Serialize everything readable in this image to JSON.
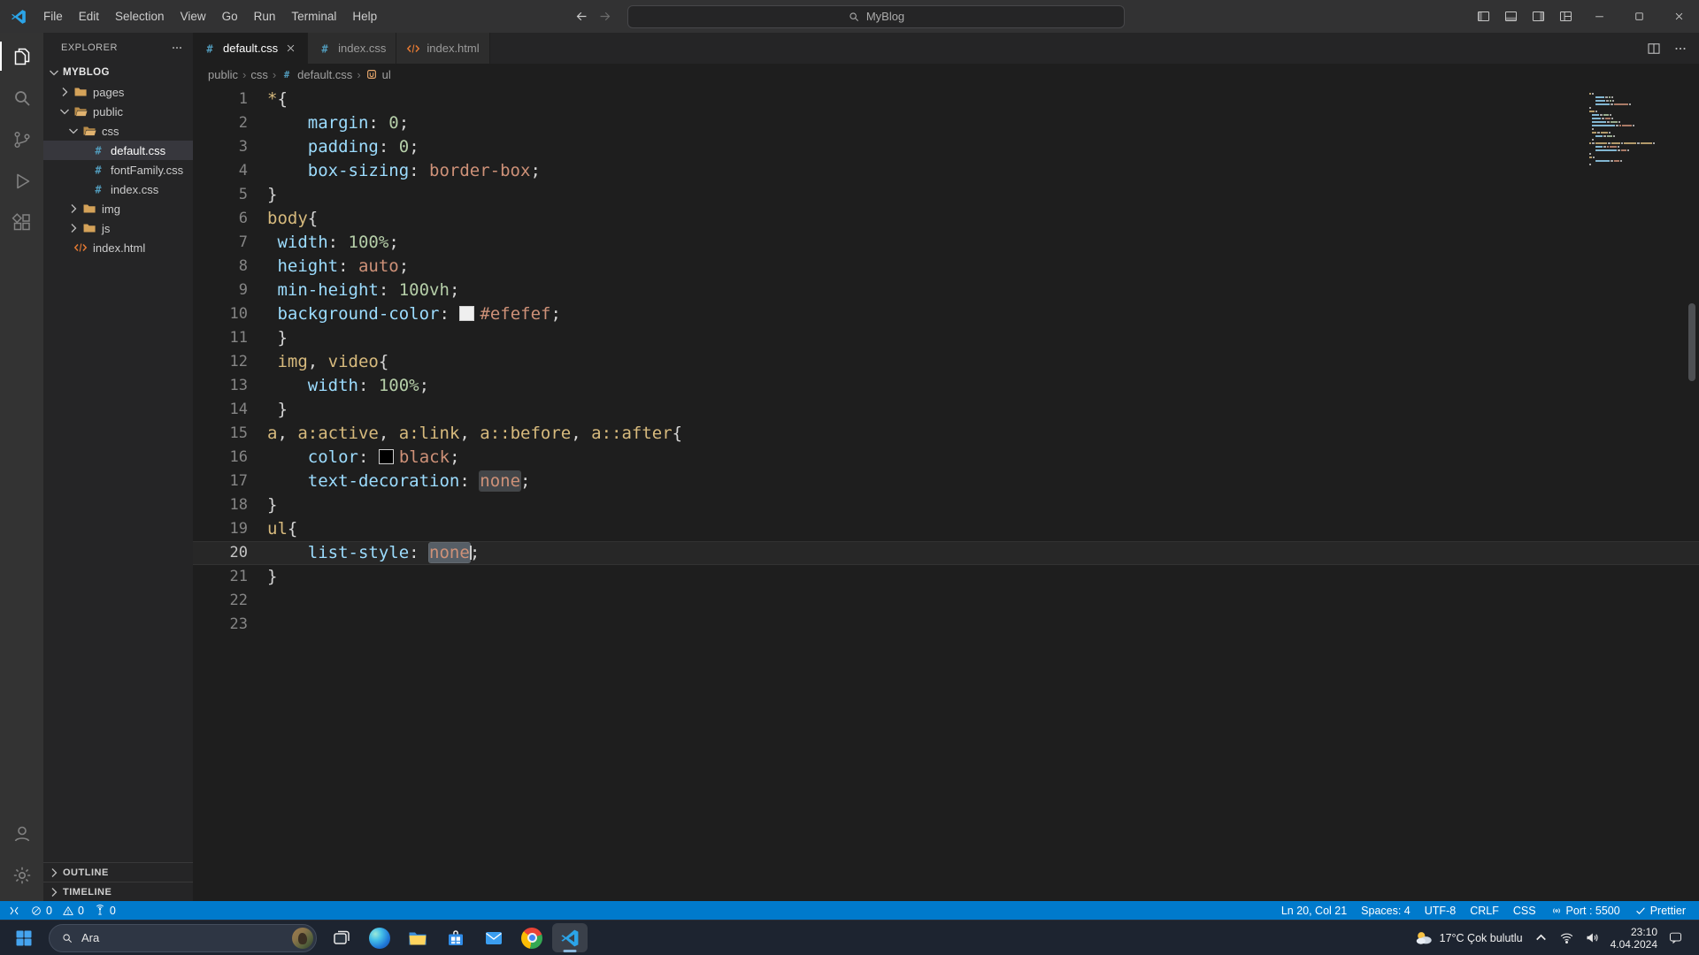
{
  "title_bar": {
    "menus": [
      "File",
      "Edit",
      "Selection",
      "View",
      "Go",
      "Run",
      "Terminal",
      "Help"
    ],
    "search_label": "MyBlog"
  },
  "activity_bar": {
    "top": [
      {
        "id": "explorer",
        "icon": "files",
        "active": true
      },
      {
        "id": "search",
        "icon": "search",
        "active": false
      },
      {
        "id": "source-control",
        "icon": "scm",
        "active": false
      },
      {
        "id": "run-and-debug",
        "icon": "debug",
        "active": false
      },
      {
        "id": "extensions",
        "icon": "extensions",
        "active": false
      }
    ],
    "bottom": [
      {
        "id": "accounts",
        "icon": "account",
        "active": false
      },
      {
        "id": "settings",
        "icon": "gear",
        "active": false
      }
    ]
  },
  "sidebar": {
    "header": "EXPLORER",
    "project": "MYBLOG",
    "tree": [
      {
        "label": "pages",
        "kind": "folder",
        "depth": 1,
        "expanded": false
      },
      {
        "label": "public",
        "kind": "folder",
        "depth": 1,
        "expanded": true
      },
      {
        "label": "css",
        "kind": "folder",
        "depth": 2,
        "expanded": true
      },
      {
        "label": "default.css",
        "kind": "css",
        "depth": 3,
        "selected": true
      },
      {
        "label": "fontFamily.css",
        "kind": "css",
        "depth": 3
      },
      {
        "label": "index.css",
        "kind": "css",
        "depth": 3
      },
      {
        "label": "img",
        "kind": "folder",
        "depth": 2,
        "expanded": false
      },
      {
        "label": "js",
        "kind": "folder",
        "depth": 2,
        "expanded": false
      },
      {
        "label": "index.html",
        "kind": "html",
        "depth": 1
      }
    ],
    "sections": [
      "OUTLINE",
      "TIMELINE"
    ]
  },
  "tabs": [
    {
      "label": "default.css",
      "icon": "css",
      "active": true
    },
    {
      "label": "index.css",
      "icon": "css",
      "active": false
    },
    {
      "label": "index.html",
      "icon": "html",
      "active": false
    }
  ],
  "breadcrumb": {
    "separator": "›",
    "items": [
      {
        "label": "public"
      },
      {
        "label": "css"
      },
      {
        "label": "default.css",
        "icon": "css"
      },
      {
        "label": "ul",
        "icon": "symbol"
      }
    ]
  },
  "editor": {
    "language": "CSS",
    "lines": [
      {
        "n": "1",
        "tk": [
          [
            "*",
            "sel"
          ],
          [
            "{",
            "pun"
          ]
        ]
      },
      {
        "n": "2",
        "tk": [
          [
            "    ",
            "pln"
          ],
          [
            "margin",
            "prop"
          ],
          [
            ": ",
            "pun"
          ],
          [
            "0",
            "num"
          ],
          [
            ";",
            "pun"
          ]
        ]
      },
      {
        "n": "3",
        "tk": [
          [
            "    ",
            "pln"
          ],
          [
            "padding",
            "prop"
          ],
          [
            ": ",
            "pun"
          ],
          [
            "0",
            "num"
          ],
          [
            ";",
            "pun"
          ]
        ]
      },
      {
        "n": "4",
        "tk": [
          [
            "    ",
            "pln"
          ],
          [
            "box-sizing",
            "prop"
          ],
          [
            ": ",
            "pun"
          ],
          [
            "border-box",
            "val"
          ],
          [
            ";",
            "pun"
          ]
        ]
      },
      {
        "n": "5",
        "tk": [
          [
            "}",
            "pun"
          ]
        ]
      },
      {
        "n": "6",
        "tk": [
          [
            "body",
            "sel"
          ],
          [
            "{",
            "pun"
          ]
        ]
      },
      {
        "n": "7",
        "tk": [
          [
            " ",
            "pln"
          ],
          [
            "width",
            "prop"
          ],
          [
            ": ",
            "pun"
          ],
          [
            "100%",
            "num"
          ],
          [
            ";",
            "pun"
          ]
        ]
      },
      {
        "n": "8",
        "tk": [
          [
            " ",
            "pln"
          ],
          [
            "height",
            "prop"
          ],
          [
            ": ",
            "pun"
          ],
          [
            "auto",
            "val"
          ],
          [
            ";",
            "pun"
          ]
        ]
      },
      {
        "n": "9",
        "tk": [
          [
            " ",
            "pln"
          ],
          [
            "min-height",
            "prop"
          ],
          [
            ": ",
            "pun"
          ],
          [
            "100vh",
            "num"
          ],
          [
            ";",
            "pun"
          ]
        ]
      },
      {
        "n": "10",
        "tk": [
          [
            " ",
            "pln"
          ],
          [
            "background-color",
            "prop"
          ],
          [
            ": ",
            "pun"
          ],
          [
            "",
            "swatch",
            "#efefef"
          ],
          [
            "#efefef",
            "val"
          ],
          [
            ";",
            "pun"
          ]
        ]
      },
      {
        "n": "11",
        "tk": [
          [
            " ",
            "pln"
          ],
          [
            "}",
            "pun"
          ]
        ]
      },
      {
        "n": "12",
        "tk": [
          [
            " ",
            "pln"
          ],
          [
            "img",
            "sel"
          ],
          [
            ", ",
            "pun"
          ],
          [
            "video",
            "sel"
          ],
          [
            "{",
            "pun"
          ]
        ]
      },
      {
        "n": "13",
        "tk": [
          [
            "    ",
            "pln"
          ],
          [
            "width",
            "prop"
          ],
          [
            ": ",
            "pun"
          ],
          [
            "100%",
            "num"
          ],
          [
            ";",
            "pun"
          ]
        ]
      },
      {
        "n": "14",
        "tk": [
          [
            " ",
            "pln"
          ],
          [
            "}",
            "pun"
          ]
        ]
      },
      {
        "n": "15",
        "tk": [
          [
            "a",
            "sel"
          ],
          [
            ", ",
            "pun"
          ],
          [
            "a:active",
            "sel"
          ],
          [
            ", ",
            "pun"
          ],
          [
            "a:link",
            "sel"
          ],
          [
            ", ",
            "pun"
          ],
          [
            "a::before",
            "sel"
          ],
          [
            ", ",
            "pun"
          ],
          [
            "a::after",
            "sel"
          ],
          [
            "{",
            "pun"
          ]
        ]
      },
      {
        "n": "16",
        "tk": [
          [
            "    ",
            "pln"
          ],
          [
            "color",
            "prop"
          ],
          [
            ": ",
            "pun"
          ],
          [
            "",
            "swatch",
            "#000000"
          ],
          [
            "black",
            "val"
          ],
          [
            ";",
            "pun"
          ]
        ]
      },
      {
        "n": "17",
        "tk": [
          [
            "    ",
            "pln"
          ],
          [
            "text-decoration",
            "prop"
          ],
          [
            ": ",
            "pun"
          ],
          [
            "none",
            "val",
            "match"
          ],
          [
            ";",
            "pun"
          ]
        ]
      },
      {
        "n": "18",
        "tk": [
          [
            "}",
            "pun"
          ]
        ]
      },
      {
        "n": "19",
        "tk": [
          [
            "ul",
            "sel"
          ],
          [
            "{",
            "pun"
          ]
        ]
      },
      {
        "n": "20",
        "current": true,
        "tk": [
          [
            "    ",
            "pln"
          ],
          [
            "list-style",
            "prop"
          ],
          [
            ": ",
            "pun"
          ],
          [
            "none",
            "val",
            "selected"
          ],
          [
            ";",
            "pun"
          ]
        ]
      },
      {
        "n": "21",
        "tk": [
          [
            "}",
            "pun"
          ]
        ]
      },
      {
        "n": "22",
        "tk": []
      },
      {
        "n": "23",
        "tk": []
      }
    ]
  },
  "status_bar": {
    "left": [
      {
        "id": "remote",
        "icon": "remote",
        "label": ""
      },
      {
        "id": "errors",
        "icon": "error",
        "label": "0"
      },
      {
        "id": "warnings",
        "icon": "warning",
        "label": "0"
      },
      {
        "id": "ports",
        "icon": "ports",
        "label": "0"
      }
    ],
    "right": [
      {
        "id": "cursor-position",
        "label": "Ln 20, Col 21"
      },
      {
        "id": "indentation",
        "label": "Spaces: 4"
      },
      {
        "id": "encoding",
        "label": "UTF-8"
      },
      {
        "id": "eol",
        "label": "CRLF"
      },
      {
        "id": "language-mode",
        "label": "CSS"
      },
      {
        "id": "live-server-port",
        "icon": "broadcast",
        "label": "Port : 5500"
      },
      {
        "id": "prettier",
        "icon": "check",
        "label": "Prettier"
      }
    ]
  },
  "taskbar": {
    "search_label": "Ara",
    "apps": [
      {
        "id": "task-view",
        "icon": "taskview",
        "active": false
      },
      {
        "id": "edge",
        "icon": "edge",
        "active": false
      },
      {
        "id": "file-explorer",
        "icon": "explorerApp",
        "active": false
      },
      {
        "id": "microsoft-store",
        "icon": "store",
        "active": false
      },
      {
        "id": "mail",
        "icon": "mail",
        "active": false
      },
      {
        "id": "chrome",
        "icon": "chrome",
        "active": false
      },
      {
        "id": "vscode",
        "icon": "vscode",
        "active": true
      }
    ],
    "weather": {
      "label": "17°C Çok bulutlu"
    },
    "clock": {
      "time": "23:10",
      "date": "4.04.2024"
    }
  },
  "colors": {
    "status_bar": "#007acc",
    "editor_background": "#1e1e1e",
    "sidebar_background": "#252526",
    "activity_bar_background": "#333333",
    "selector": "#d7ba7d",
    "property": "#9cdcfe",
    "number": "#b5cea8",
    "value": "#ce9178"
  }
}
